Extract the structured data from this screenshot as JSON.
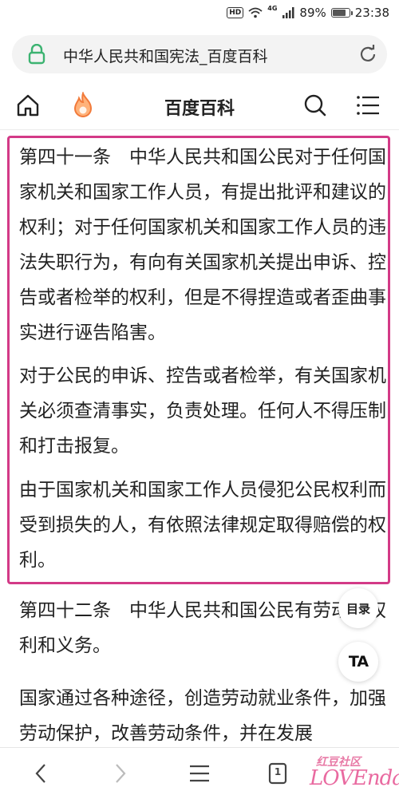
{
  "status_bar": {
    "hd": "HD",
    "network": "4G",
    "battery": "89%",
    "battery_level": 0.89,
    "time": "23:38"
  },
  "url_bar": {
    "title": "中华人民共和国宪法_百度百科"
  },
  "header": {
    "site_title": "百度百科"
  },
  "content": {
    "paragraphs": [
      "第四十一条　中华人民共和国公民对于任何国家机关和国家工作人员，有提出批评和建议的权利；对于任何国家机关和国家工作人员的违法失职行为，有向有关国家机关提出申诉、控告或者检举的权利，但是不得捏造或者歪曲事实进行诬告陷害。",
      "对于公民的申诉、控告或者检举，有关国家机关必须查清事实，负责处理。任何人不得压制和打击报复。",
      "由于国家机关和国家工作人员侵犯公民权利而受到损失的人，有依照法律规定取得赔偿的权利。",
      "第四十二条　中华人民共和国公民有劳动的权利和义务。",
      "国家通过各种途径，创造劳动就业条件，加强劳动保护，改善劳动条件，并在发展"
    ],
    "highlight_color": "#d33a87"
  },
  "floating": {
    "toc_label": "目录",
    "font_label": "TA"
  },
  "bottom_bar": {
    "tab_count": "1"
  },
  "watermark": {
    "top": "红豆社区",
    "bottom": "LOVEnda"
  },
  "icons": {
    "lock": "lock-icon",
    "reload": "reload-icon",
    "home": "home-icon",
    "flame": "flame-icon",
    "search": "search-icon",
    "menu": "menu-icon",
    "back": "back-icon",
    "forward": "forward-icon",
    "hamburger": "hamburger-icon",
    "tabs": "tabs-icon"
  }
}
